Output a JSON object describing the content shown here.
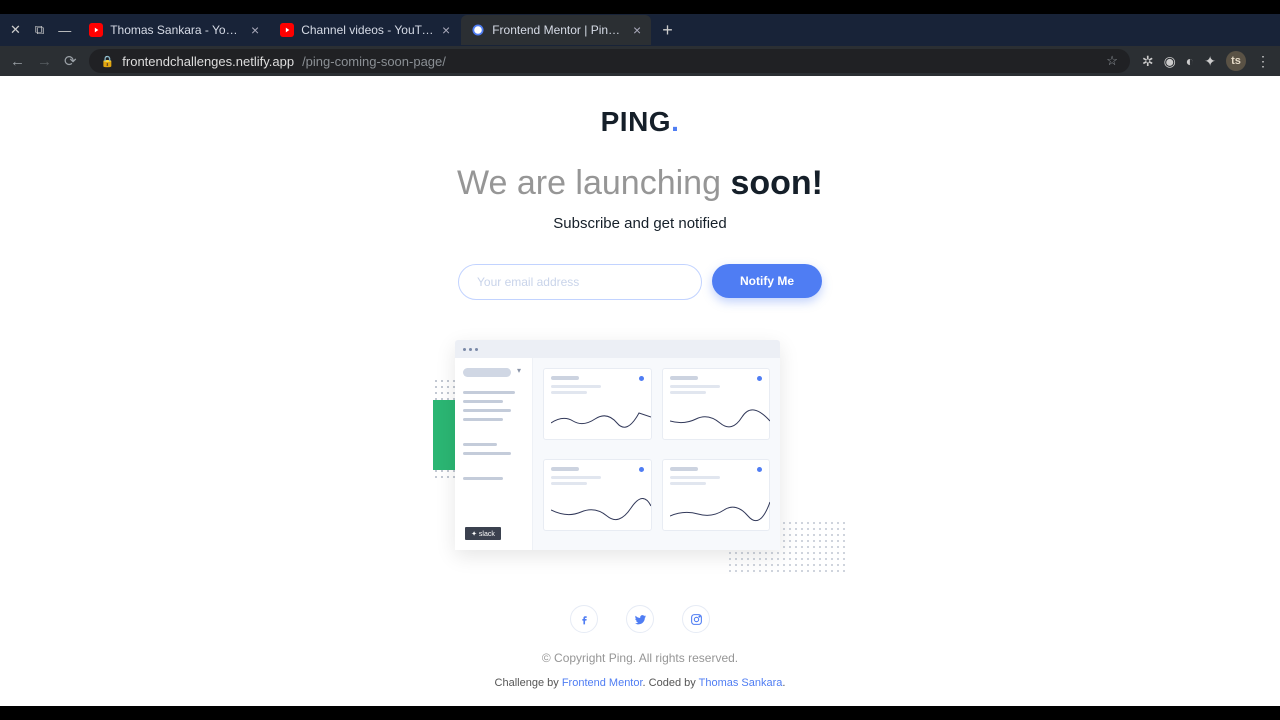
{
  "browser": {
    "tabs": [
      {
        "title": "Thomas Sankara - YouTub",
        "favicon": "youtube"
      },
      {
        "title": "Channel videos - YouTube",
        "favicon": "youtube"
      },
      {
        "title": "Frontend Mentor | Ping co",
        "favicon": "circle"
      }
    ],
    "url_host": "frontendchallenges.netlify.app",
    "url_path": "/ping-coming-soon-page/",
    "avatar": "ts"
  },
  "page": {
    "logo_text": "PING",
    "logo_dot": ".",
    "headline_prefix": "We are launching ",
    "headline_bold": "soon!",
    "subtext": "Subscribe and get notified",
    "email_placeholder": "Your email address",
    "notify_label": "Notify Me",
    "slack_label": "✦ slack",
    "copyright": "© Copyright Ping. All rights reserved.",
    "attribution_prefix": "Challenge by ",
    "attribution_link1": "Frontend Mentor",
    "attribution_mid": ". Coded by ",
    "attribution_link2": "Thomas Sankara",
    "attribution_suffix": "."
  }
}
